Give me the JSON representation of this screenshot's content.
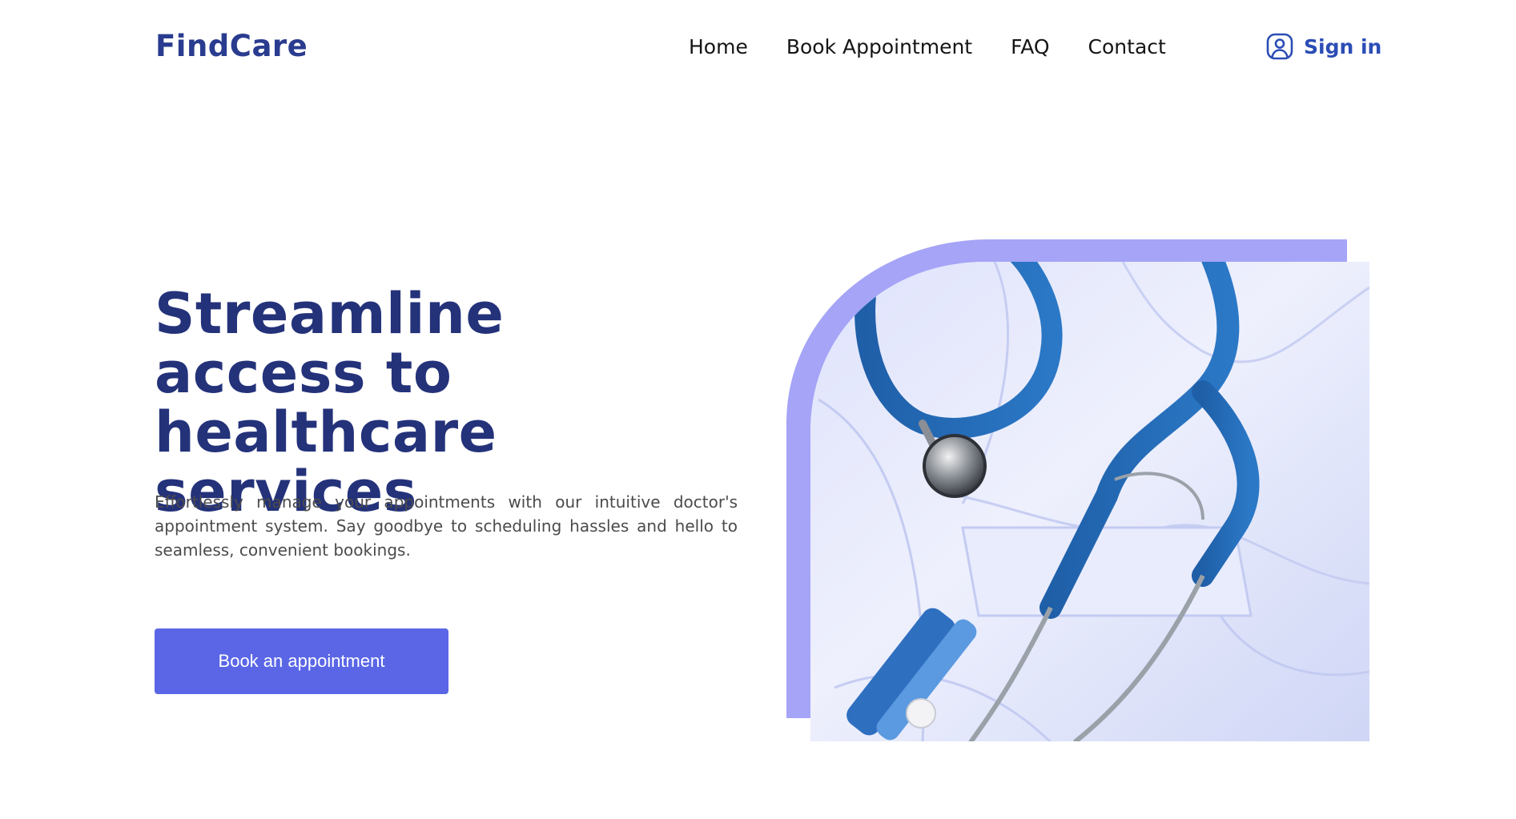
{
  "brand": {
    "name": "FindCare",
    "color": "#2a3c8f"
  },
  "nav": {
    "items": [
      {
        "label": "Home"
      },
      {
        "label": "Book Appointment"
      },
      {
        "label": "FAQ"
      },
      {
        "label": "Contact"
      }
    ]
  },
  "auth": {
    "signin_label": "Sign in",
    "icon": "user-square-icon"
  },
  "hero": {
    "title": "Streamline access to healthcare services",
    "subtitle": "Effortlessly manage your appointments with our intuitive doctor's appointment system. Say goodbye to scheduling hassles and hello to seamless, convenient bookings.",
    "cta_label": "Book an appointment",
    "image": "stethoscope-on-white-coat",
    "colors": {
      "title": "#24327a",
      "cta": "#5a66e6",
      "accent_frame": "#a5a4f7"
    }
  }
}
